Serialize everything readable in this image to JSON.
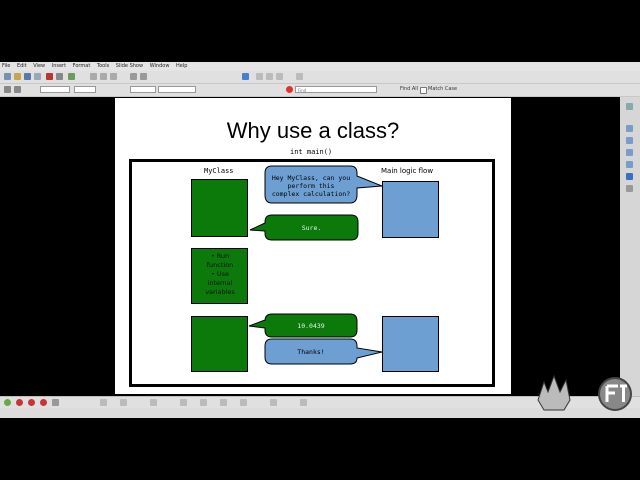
{
  "menu": [
    "File",
    "Edit",
    "View",
    "Insert",
    "Format",
    "Tools",
    "Slide Show",
    "Window",
    "Help"
  ],
  "toolbar": {
    "find_label": "Find All",
    "match_case_label": "Match Case",
    "search_placeholder": "Find"
  },
  "slide": {
    "title": "Why use a class?",
    "code_label": "int main()",
    "myclass_label": "MyClass",
    "main_flow_label": "Main logic flow",
    "bubble_question": [
      "Hey MyClass, can you",
      "perform this",
      "complex calculation?"
    ],
    "bubble_sure": "Sure.",
    "bullets": [
      "• Run",
      "function",
      "• Use",
      "internal",
      "variables"
    ],
    "bubble_value": "10.0439",
    "bubble_thanks": "Thanks!"
  },
  "colors": {
    "green": "#0b7a0b",
    "blue": "#6e9fd2",
    "frame": "#000000"
  }
}
